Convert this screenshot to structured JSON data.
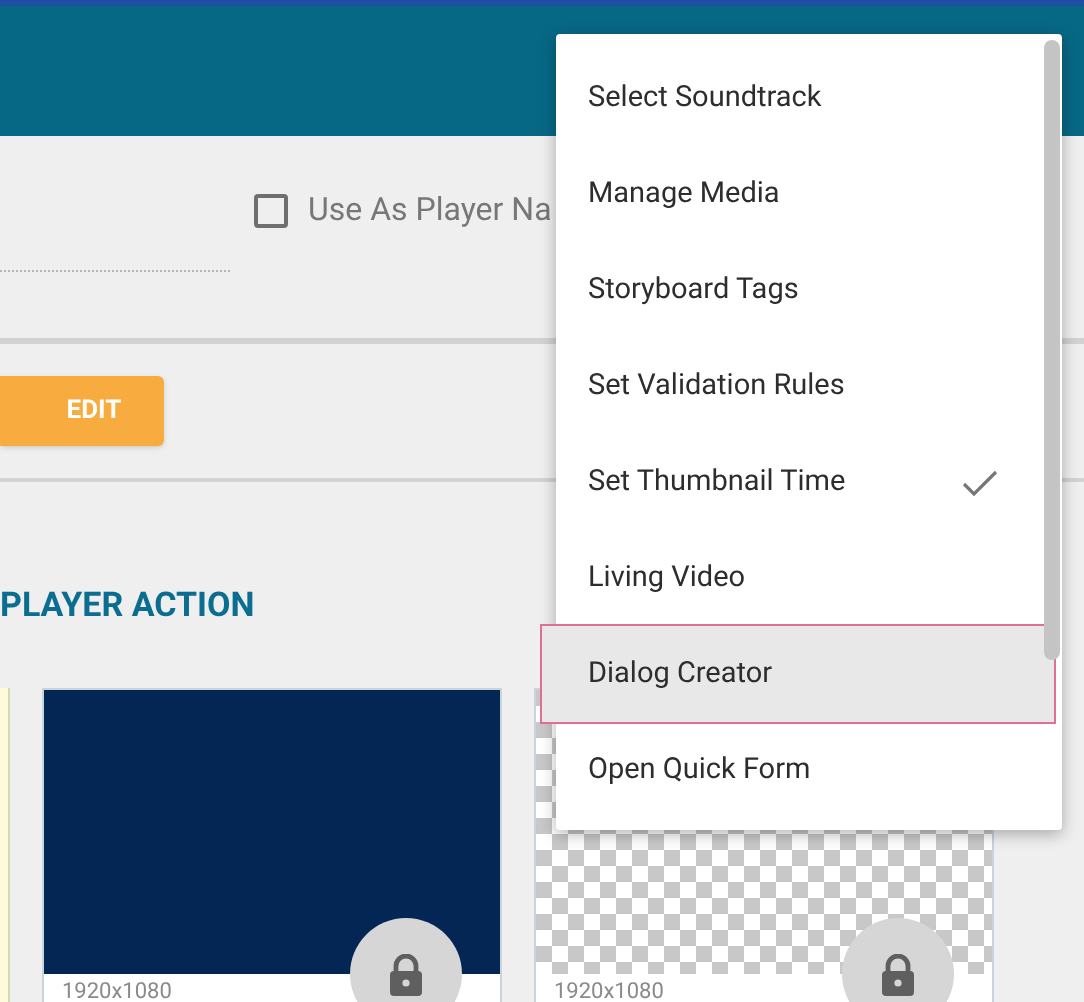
{
  "form": {
    "checkbox": {
      "label": "Use As Player Na",
      "checked": false
    },
    "edit_button": "EDIT"
  },
  "section": {
    "title": "PLAYER ACTION",
    "cards": [
      {
        "kind": "solid",
        "size": "1920x1080",
        "locked": true
      },
      {
        "kind": "transparent",
        "size": "1920x1080",
        "locked": true
      }
    ]
  },
  "menu": {
    "items": [
      {
        "label": "Select Soundtrack",
        "checked": false,
        "selected": false
      },
      {
        "label": "Manage Media",
        "checked": false,
        "selected": false
      },
      {
        "label": "Storyboard Tags",
        "checked": false,
        "selected": false
      },
      {
        "label": "Set Validation Rules",
        "checked": false,
        "selected": false
      },
      {
        "label": "Set Thumbnail Time",
        "checked": true,
        "selected": false
      },
      {
        "label": "Living Video",
        "checked": false,
        "selected": false
      },
      {
        "label": "Dialog Creator",
        "checked": false,
        "selected": true
      },
      {
        "label": "Open Quick Form",
        "checked": false,
        "selected": false
      }
    ]
  }
}
